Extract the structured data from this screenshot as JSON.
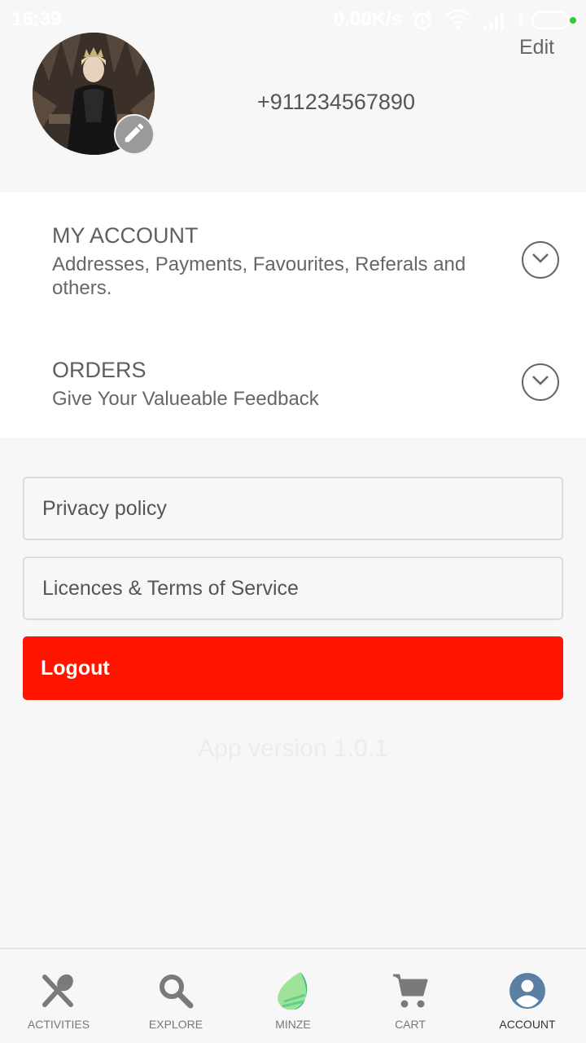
{
  "status_bar": {
    "time": "16:39",
    "network_speed": "0.00K/s",
    "icons": [
      "alarm-icon",
      "wifi-icon",
      "signal-icon",
      "battery-icon"
    ]
  },
  "profile": {
    "phone": "+911234567890",
    "edit_label": "Edit"
  },
  "sections": [
    {
      "title": "MY ACCOUNT",
      "subtitle": "Addresses, Payments, Favourites, Referals and others."
    },
    {
      "title": "ORDERS",
      "subtitle": "Give Your Valueable Feedback"
    }
  ],
  "links": {
    "privacy": "Privacy policy",
    "licences": "Licences & Terms of Service",
    "logout": "Logout"
  },
  "app_version": "App version 1.0.1",
  "bottom_nav": [
    {
      "label": "ACTIVITIES",
      "icon": "fork-spoon-icon"
    },
    {
      "label": "EXPLORE",
      "icon": "search-icon"
    },
    {
      "label": "MINZE",
      "icon": "leaf-logo-icon"
    },
    {
      "label": "CART",
      "icon": "cart-icon"
    },
    {
      "label": "ACCOUNT",
      "icon": "account-circle-icon",
      "active": true
    }
  ],
  "colors": {
    "logout": "#ff1400",
    "account_icon": "#5b7fa3",
    "leaf_light": "#9fe39a",
    "leaf_dark": "#2fb87a"
  }
}
